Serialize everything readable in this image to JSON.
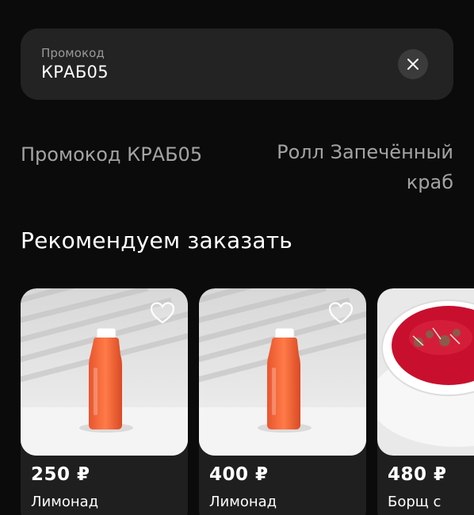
{
  "promo": {
    "label": "Промокод",
    "value": "КРАБ05",
    "clear_icon": "close-icon"
  },
  "promo_info": {
    "left": "Промокод КРАБ05",
    "right": "Ролл Запечённый краб"
  },
  "recommendations": {
    "title": "Рекомендуем заказать",
    "items": [
      {
        "price": "250 ₽",
        "name": "Лимонад",
        "image": "orange-juice-bottle",
        "favorite_icon": "heart-icon"
      },
      {
        "price": "400 ₽",
        "name": "Лимонад",
        "image": "orange-juice-bottle",
        "favorite_icon": "heart-icon"
      },
      {
        "price": "480 ₽",
        "name": "Борщ с",
        "image": "borscht-bowl",
        "favorite_icon": "heart-icon"
      }
    ]
  }
}
